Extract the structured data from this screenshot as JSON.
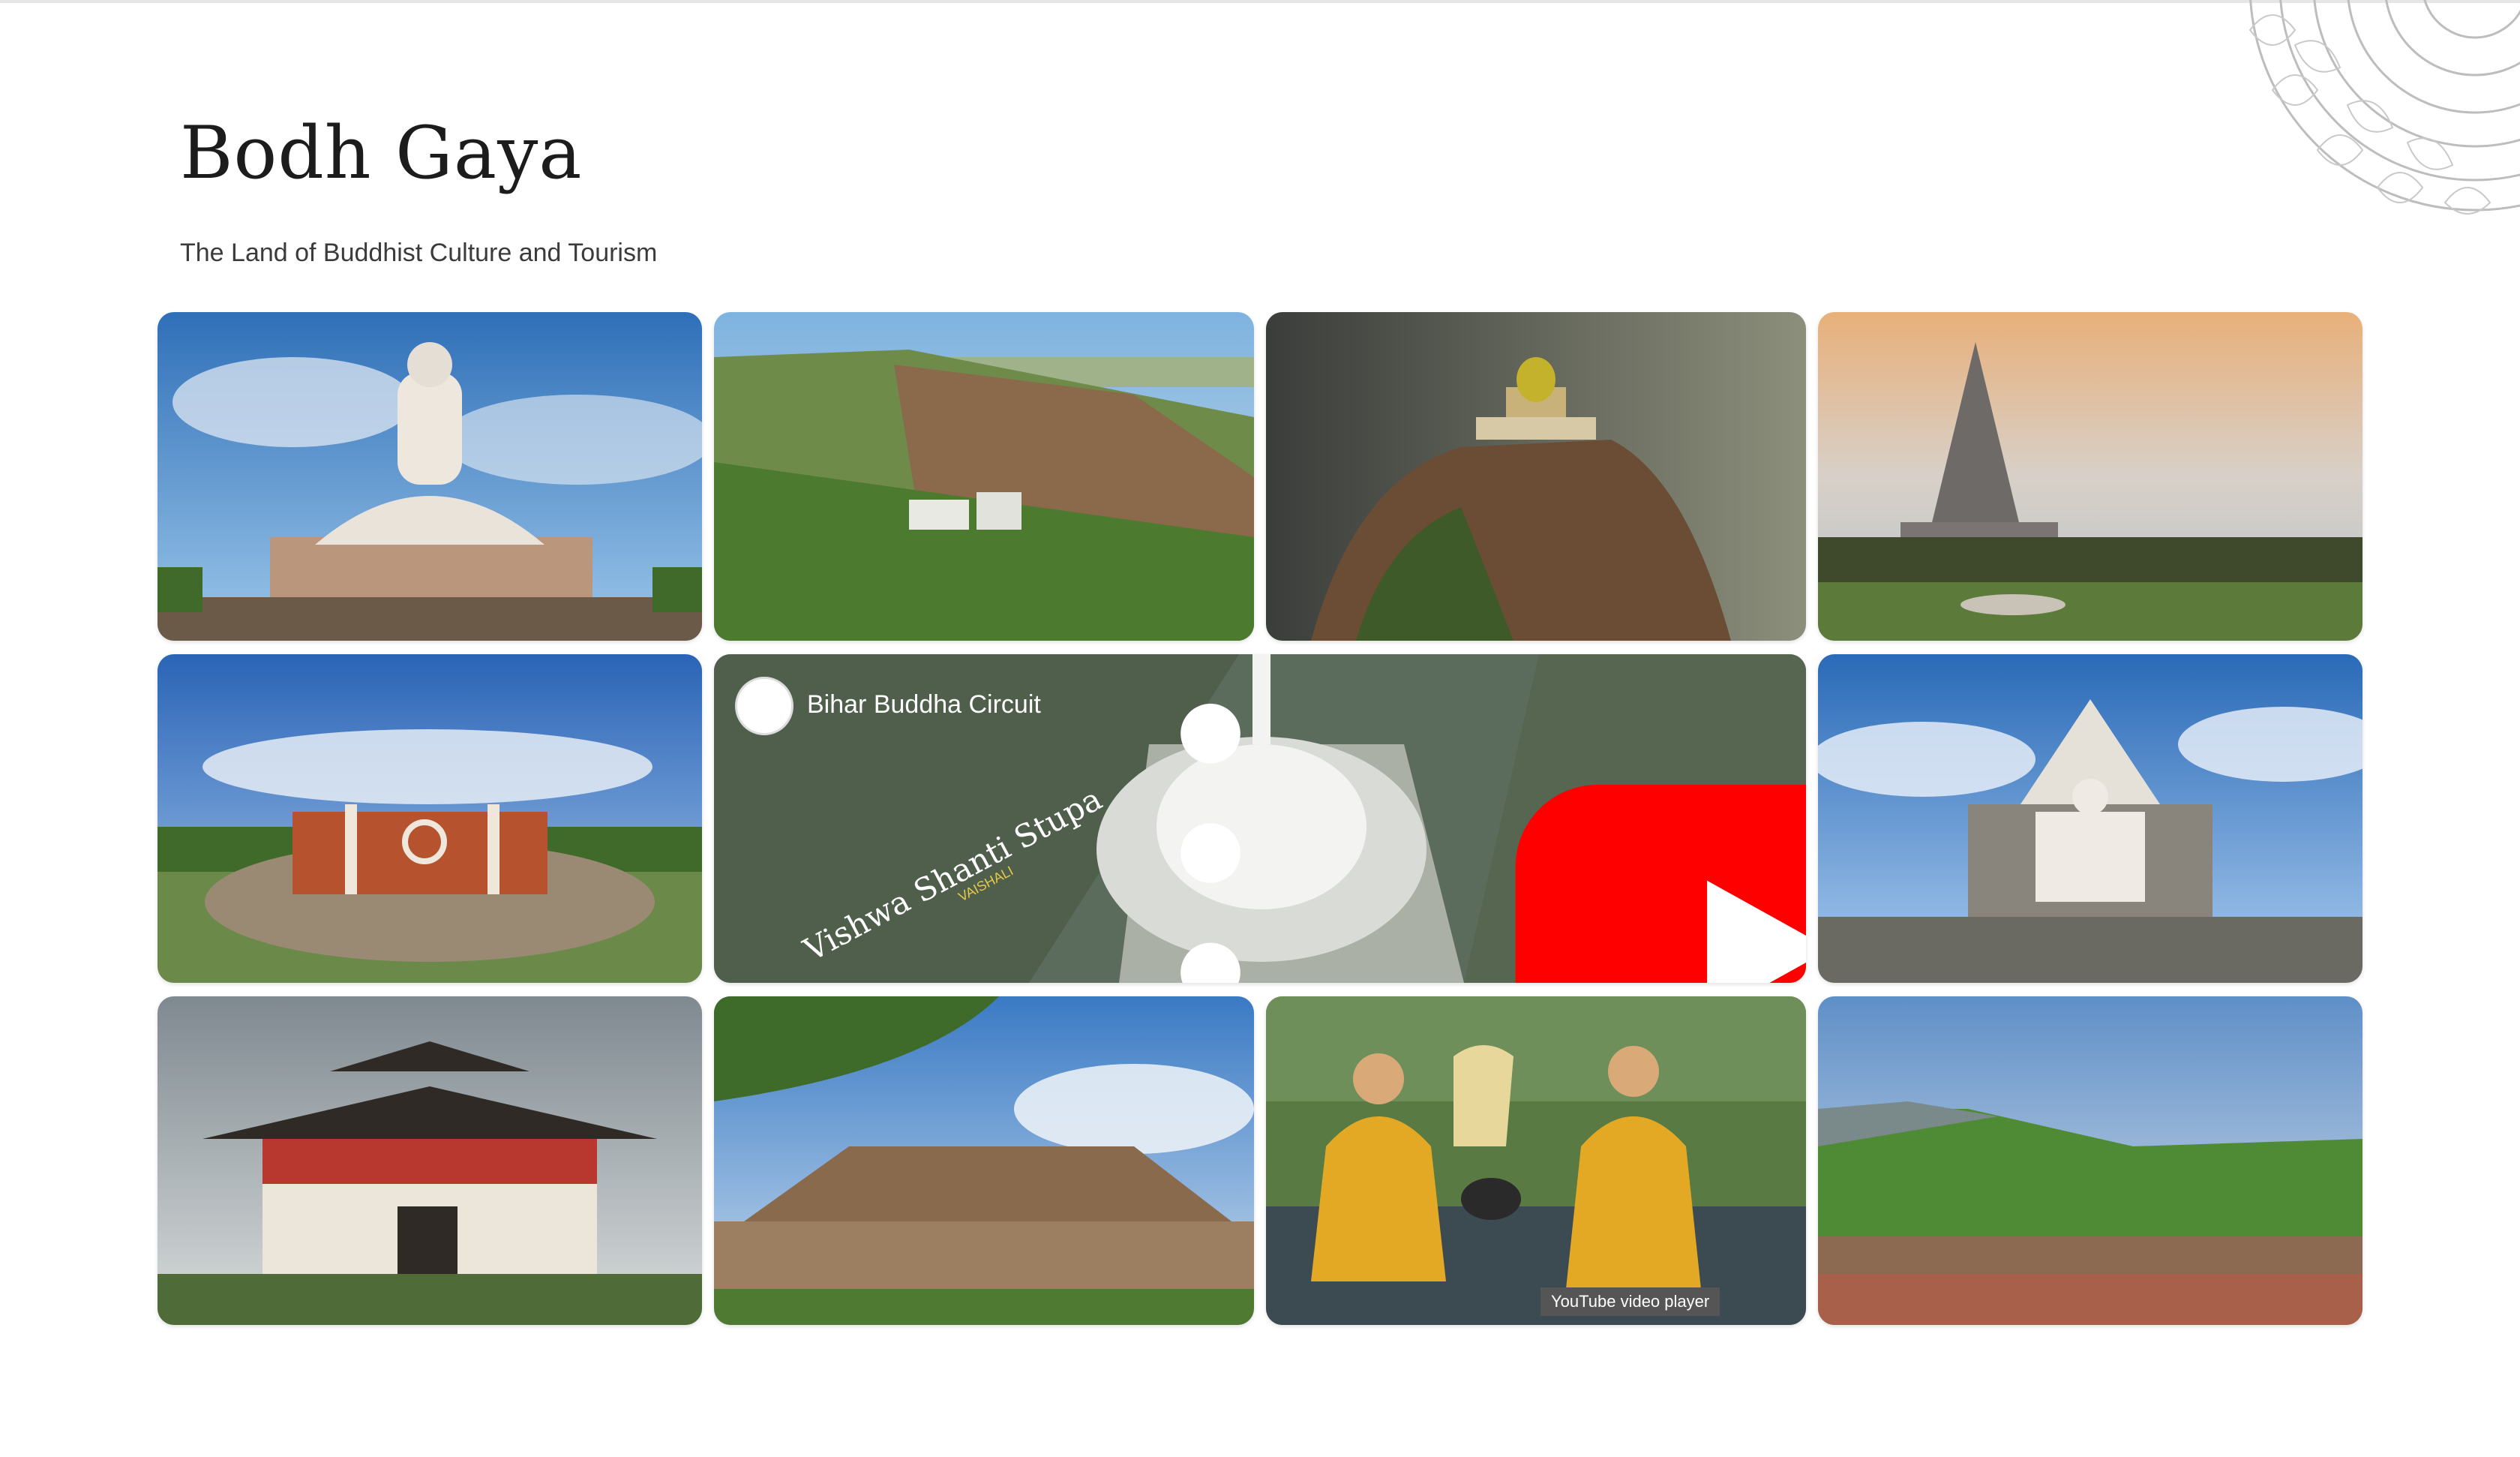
{
  "page": {
    "title": "Bodh Gaya",
    "subtitle": "The Land of Buddhist Culture and Tourism"
  },
  "gallery": {
    "video": {
      "title": "Bihar Buddha Circuit",
      "overlay_text": "Vishwa Shanti Stupa",
      "overlay_subtext": "VAISHALI",
      "tooltip": "YouTube video player"
    }
  },
  "colors": {
    "youtube_red": "#ff0000",
    "title_text": "#1c1c1c",
    "subtitle_text": "#3b3b3b"
  }
}
